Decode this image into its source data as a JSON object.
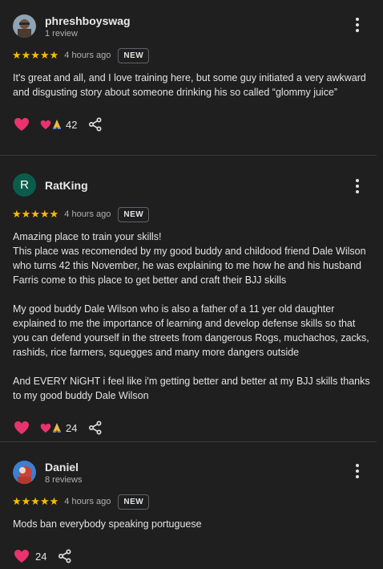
{
  "reviews": [
    {
      "author": "phreshboyswag",
      "review_count": "1 review",
      "stars": "★★★★★",
      "time": "4 hours ago",
      "badge": "NEW",
      "paragraphs": [
        "It's great and all, and I love training here, but some guy initiated a very awkward and disgusting story about someone drinking his so called “glommy juice”"
      ],
      "reaction_count": "42",
      "avatar_icon": "photo-avatar-icon"
    },
    {
      "author": "RatKing",
      "avatar_letter": "R",
      "stars": "★★★★★",
      "time": "4 hours ago",
      "badge": "NEW",
      "paragraphs": [
        "Amazing place to train your skills!\nThis place was recomended by my good buddy and childood friend Dale Wilson who turns 42 this November, he was explaining to me how he and his husband Farris come to this place to get better and craft their BJJ skills",
        "My good buddy Dale Wilson who is also a father of a 11 yer old daughter explained to me the importance of learning and develop defense skills so that you can defend yourself in the streets from dangerous Rogs, muchachos, zacks, rashids, rice farmers, squegges and many more dangers outside",
        "And EVERY NiGHT i feel like i'm getting better and better at my BJJ skills thanks to my good buddy Dale Wilson"
      ],
      "reaction_count": "24"
    },
    {
      "author": "Daniel",
      "review_count": "8 reviews",
      "stars": "★★★★★",
      "time": "4 hours ago",
      "badge": "NEW",
      "paragraphs": [
        "Mods ban everybody speaking portuguese"
      ],
      "reaction_count": "24",
      "avatar_icon": "photo-avatar-icon"
    }
  ],
  "colors": {
    "background": "#1f1f1f",
    "star": "#fbbc04",
    "heart": "#e8336f",
    "avatar_letter_bg": "#0b5d4b",
    "divider": "#3c3c3c"
  }
}
